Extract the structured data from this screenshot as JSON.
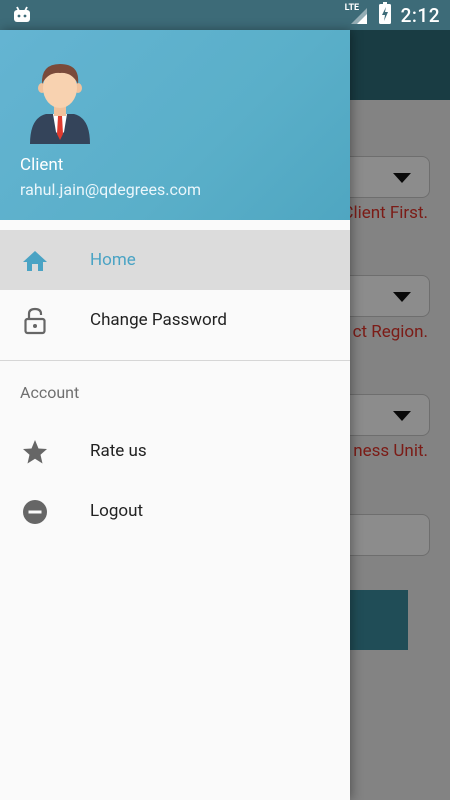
{
  "status_bar": {
    "network": "LTE",
    "time": "2:12"
  },
  "background_form": {
    "errors": [
      "Client First.",
      "ct Region.",
      "ness Unit."
    ]
  },
  "drawer": {
    "user": {
      "name": "Client",
      "email": "rahul.jain@qdegrees.com"
    },
    "items": [
      {
        "label": "Home",
        "icon": "home-icon",
        "active": true
      },
      {
        "label": "Change Password",
        "icon": "unlock-icon",
        "active": false
      }
    ],
    "section_title": "Account",
    "account_items": [
      {
        "label": "Rate us",
        "icon": "star-icon"
      },
      {
        "label": "Logout",
        "icon": "minus-circle-icon"
      }
    ]
  },
  "colors": {
    "accent": "#4aa3c4",
    "header": "#5aafc9",
    "toolbar": "#2f6d7b",
    "error": "#e0342a"
  }
}
